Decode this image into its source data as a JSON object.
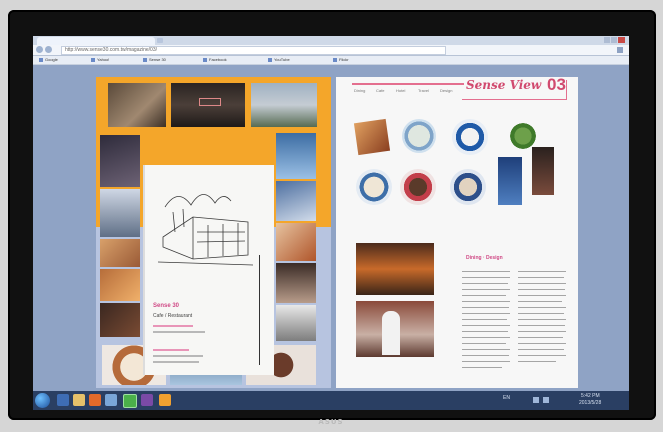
{
  "browser": {
    "url": "http://www.sense30.com.tw/magazine/03/",
    "bookmarks": [
      "Google",
      "Yahoo!",
      "Sense 30",
      "Facebook",
      "YouTube",
      "Flickr"
    ]
  },
  "left_page": {
    "card_title": "Sense 30",
    "card_subtitle": "Cafe / Restaurant"
  },
  "right_page": {
    "nav_labels": [
      "Dining",
      "Cafe",
      "Hotel",
      "Travel",
      "Design"
    ],
    "header_title": "Sense View",
    "header_number": "03",
    "article_title": "Dining · Design"
  },
  "taskbar": {
    "tray_text": "EN",
    "time": "5:42 PM",
    "date": "2013/5/28"
  },
  "monitor_brand": "ASUS",
  "colors": {
    "accent_pink": "#d14a6f",
    "left_page_orange": "#f4a62a",
    "taskbar": "#2a3f63"
  }
}
